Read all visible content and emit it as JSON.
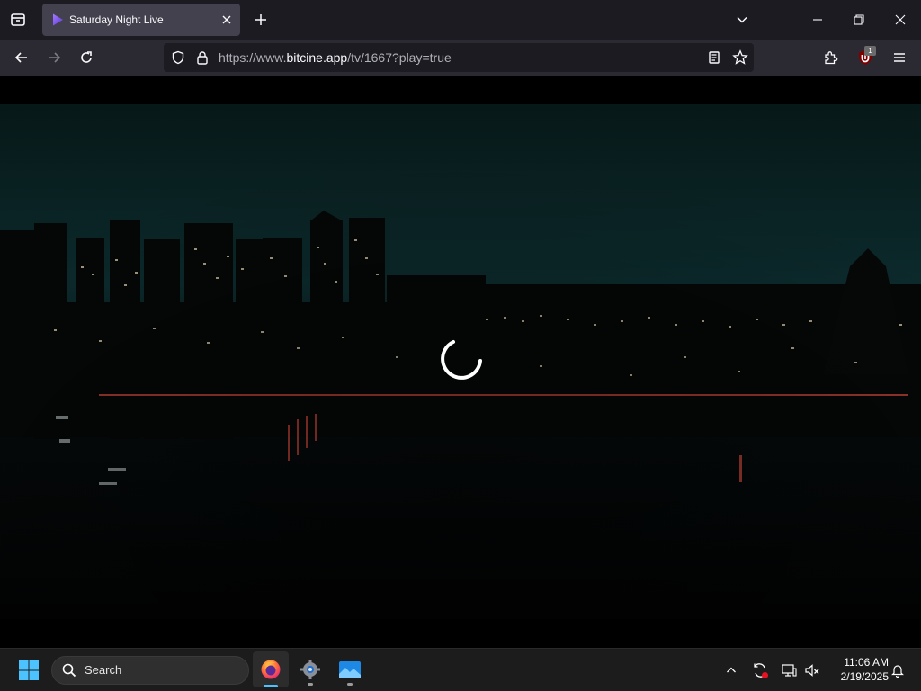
{
  "browser": {
    "tab": {
      "title": "Saturday Night Live",
      "favicon": "play-triangle-icon"
    },
    "address_bar": {
      "url_prefix": "https://www.",
      "url_host": "bitcine.app",
      "url_path": "/tv/1667?play=true"
    },
    "extension_badge": "1",
    "accent_color": "#7542e5"
  },
  "player": {
    "state": "loading",
    "spinner_icon": "loading-spinner-icon",
    "scene": "night-city-skyline"
  },
  "taskbar": {
    "search_label": "Search",
    "apps": [
      "firefox-icon",
      "settings-gear-icon",
      "photos-icon"
    ],
    "clock": {
      "time": "11:06 AM",
      "date": "2/19/2025"
    }
  }
}
